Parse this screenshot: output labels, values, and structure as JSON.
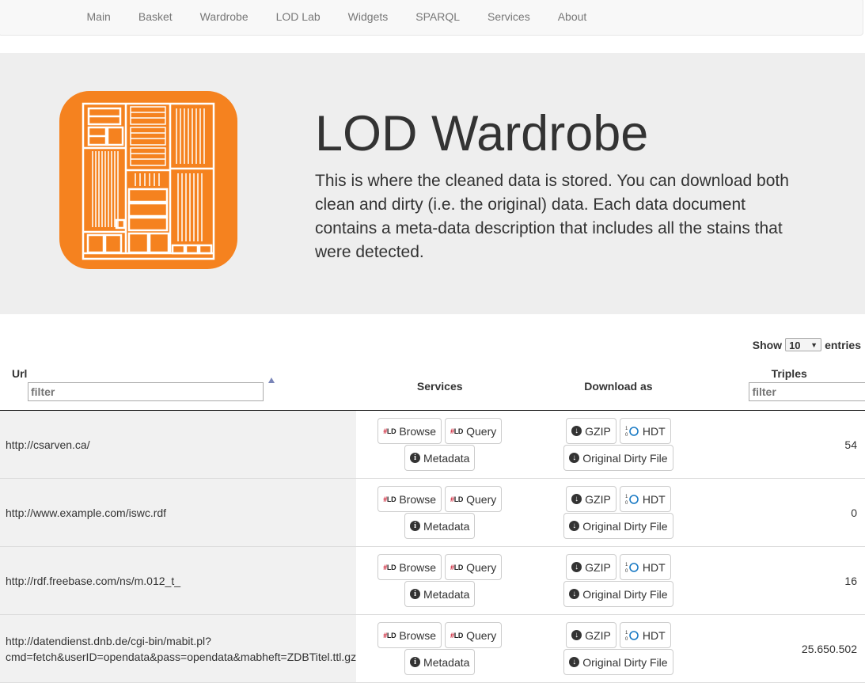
{
  "nav": {
    "items": [
      {
        "label": "Main"
      },
      {
        "label": "Basket"
      },
      {
        "label": "Wardrobe"
      },
      {
        "label": "LOD Lab"
      },
      {
        "label": "Widgets"
      },
      {
        "label": "SPARQL"
      },
      {
        "label": "Services"
      },
      {
        "label": "About"
      }
    ]
  },
  "hero": {
    "title": "LOD Wardrobe",
    "description": "This is where the cleaned data is stored. You can download both clean and dirty (i.e. the original) data. Each data document contains a meta-data description that includes all the stains that were detected.",
    "logo_icon": "wardrobe-logo-icon",
    "accent_color": "#f5821f"
  },
  "table": {
    "show_label": "Show",
    "entries_label": "entries",
    "page_size": "10",
    "columns": {
      "url": "Url",
      "services": "Services",
      "download": "Download as",
      "triples": "Triples"
    },
    "filter_placeholder": "filter",
    "rows": [
      {
        "url": "http://csarven.ca/",
        "triples": "54"
      },
      {
        "url": "http://www.example.com/iswc.rdf",
        "triples": "0"
      },
      {
        "url": "http://rdf.freebase.com/ns/m.012_t_",
        "triples": "16"
      },
      {
        "url": "http://datendienst.dnb.de/cgi-bin/mabit.pl?cmd=fetch&userID=opendata&pass=opendata&mabheft=ZDBTitel.ttl.gz",
        "triples": "25.650.502"
      }
    ],
    "buttons": {
      "browse": "Browse",
      "query": "Query",
      "metadata": "Metadata",
      "gzip": "GZIP",
      "hdt": "HDT",
      "dirty": "Original Dirty File",
      "ld_badge_hash": "#",
      "ld_badge_text": "LD"
    }
  }
}
